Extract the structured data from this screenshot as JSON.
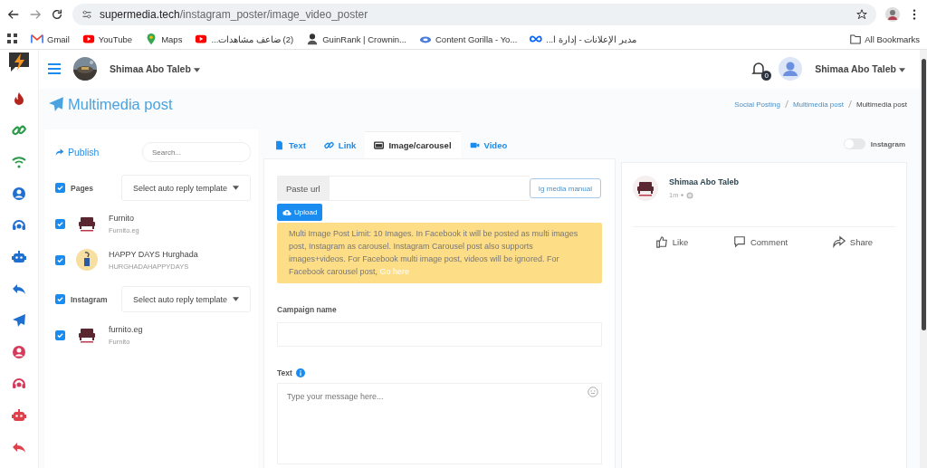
{
  "browser": {
    "url_host": "supermedia.tech",
    "url_path": "/instagram_poster/image_video_poster",
    "bookmarks": [
      {
        "label": "Gmail",
        "kind": "gmail"
      },
      {
        "label": "YouTube",
        "kind": "youtube"
      },
      {
        "label": "Maps",
        "kind": "maps"
      },
      {
        "label": "(2) ضاعف مشاهدات...",
        "kind": "youtube"
      },
      {
        "label": "GuinRank | Crownin...",
        "kind": "person"
      },
      {
        "label": "Content Gorilla - Yo...",
        "kind": "cloud"
      },
      {
        "label": "مدير الإعلانات - إدارة ا...",
        "kind": "meta"
      }
    ],
    "all_bookmarks": "All Bookmarks"
  },
  "navbar": {
    "user_name": "Shimaa Abo Taleb",
    "notification_count": "0",
    "profile_name": "Shimaa Abo Taleb"
  },
  "page": {
    "title": "Multimedia post",
    "breadcrumbs": [
      {
        "label": "Social Posting",
        "current": false
      },
      {
        "label": "Multimedia post",
        "current": false
      },
      {
        "label": "Multimedia post",
        "current": true
      }
    ]
  },
  "accounts_panel": {
    "publish": "Publish",
    "search_placeholder": "Search...",
    "groups": [
      {
        "label": "Pages",
        "checked": true,
        "template_placeholder": "Select auto reply template",
        "accounts": [
          {
            "name": "Furnito",
            "handle": "Furnito.eg",
            "checked": true,
            "kind": "sofa"
          },
          {
            "name": "HAPPY DAYS Hurghada",
            "handle": "HURGHADAHAPPYDAYS",
            "checked": true,
            "kind": "sign"
          }
        ]
      },
      {
        "label": "Instagram",
        "checked": true,
        "template_placeholder": "Select auto reply template",
        "accounts": [
          {
            "name": "furnito.eg",
            "handle": "Furnito",
            "checked": true,
            "kind": "sofa"
          }
        ]
      }
    ]
  },
  "tabs": [
    {
      "label": "Text",
      "selected": false
    },
    {
      "label": "Link",
      "selected": false
    },
    {
      "label": "Image/carousel",
      "selected": true
    },
    {
      "label": "Video",
      "selected": false
    }
  ],
  "instagram_toggle": {
    "label": "Instagram",
    "on": false
  },
  "form": {
    "paste_url_label": "Paste url",
    "media_button": "Ig media manual",
    "upload_button": "Upload",
    "alert": "Multi Image Post Limit: 10 Images. In Facebook it will be posted as multi images post, Instagram as carousel. Instagram Carousel post also supports images+videos. For Facebook multi image post, videos will be ignored. For Facebook carousel post,",
    "alert_link": "Go here",
    "campaign_label": "Campaign name",
    "text_label": "Text",
    "text_placeholder": "Type your message here..."
  },
  "preview": {
    "name": "Shimaa Abo Taleb",
    "time": "1m",
    "actions": [
      {
        "label": "Like"
      },
      {
        "label": "Comment"
      },
      {
        "label": "Share"
      }
    ]
  }
}
